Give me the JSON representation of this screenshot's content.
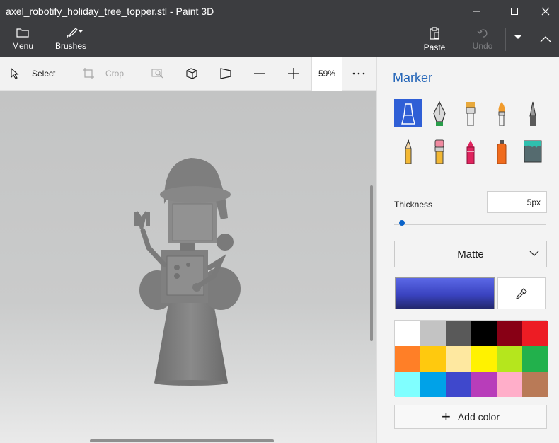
{
  "window": {
    "title": "axel_robotify_holiday_tree_topper.stl - Paint 3D"
  },
  "ribbon": {
    "menu_label": "Menu",
    "brushes_label": "Brushes",
    "paste_label": "Paste",
    "undo_label": "Undo"
  },
  "toolbar": {
    "select_label": "Select",
    "crop_label": "Crop",
    "zoom_value": "59%"
  },
  "panel": {
    "title": "Marker",
    "brushes": [
      {
        "icon": "marker-icon",
        "selected": true
      },
      {
        "icon": "calligraphy-pen-icon"
      },
      {
        "icon": "oil-brush-icon"
      },
      {
        "icon": "watercolor-icon"
      },
      {
        "icon": "pencil-icon"
      },
      {
        "icon": "eraser-icon"
      },
      {
        "icon": "crayon-icon"
      },
      {
        "icon": "pixel-pen-icon"
      },
      {
        "icon": "spray-can-icon"
      },
      {
        "icon": "fill-bucket-icon"
      }
    ],
    "thickness_label": "Thickness",
    "thickness_value": "5px",
    "thickness_fraction": 0.05,
    "finish_value": "Matte",
    "current_color": "#3a43c0",
    "swatches": [
      "#ffffff",
      "#c3c3c3",
      "#595959",
      "#000000",
      "#880015",
      "#ed1c24",
      "#ff7f27",
      "#ffc90e",
      "#fee8a0",
      "#fff200",
      "#b5e61d",
      "#22b14c",
      "#80ffff",
      "#00a2e8",
      "#3f48cc",
      "#b83dba",
      "#ffaec9",
      "#b97a57"
    ],
    "add_color_label": "Add color"
  }
}
